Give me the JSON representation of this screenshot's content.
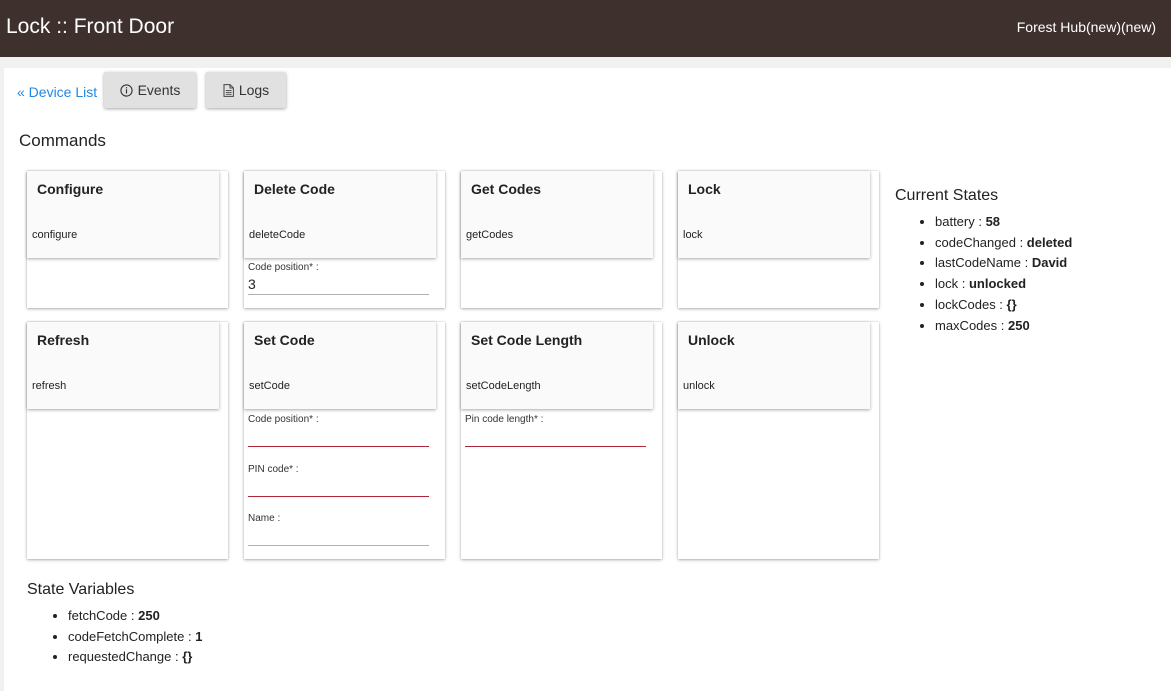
{
  "header": {
    "title": "Lock :: Front Door",
    "hub": "Forest Hub(new)(new)"
  },
  "nav": {
    "device_list": "« Device List",
    "events": "Events",
    "logs": "Logs"
  },
  "commands": {
    "title": "Commands",
    "configure": {
      "name": "Configure",
      "cmd": "configure"
    },
    "delete_code": {
      "name": "Delete Code",
      "cmd": "deleteCode",
      "code_position_label": "Code position* :",
      "code_position_value": "3"
    },
    "get_codes": {
      "name": "Get Codes",
      "cmd": "getCodes"
    },
    "lock": {
      "name": "Lock",
      "cmd": "lock"
    },
    "refresh": {
      "name": "Refresh",
      "cmd": "refresh"
    },
    "set_code": {
      "name": "Set Code",
      "cmd": "setCode",
      "code_position_label": "Code position* :",
      "code_position_value": "",
      "pin_label": "PIN code* :",
      "pin_value": "",
      "name_label": "Name :",
      "name_value": ""
    },
    "set_code_length": {
      "name": "Set Code Length",
      "cmd": "setCodeLength",
      "pin_length_label": "Pin code length* :",
      "pin_length_value": ""
    },
    "unlock": {
      "name": "Unlock",
      "cmd": "unlock"
    }
  },
  "current_states": {
    "title": "Current States",
    "items": [
      {
        "key": "battery : ",
        "value": "58"
      },
      {
        "key": "codeChanged : ",
        "value": "deleted"
      },
      {
        "key": "lastCodeName : ",
        "value": "David"
      },
      {
        "key": "lock : ",
        "value": "unlocked"
      },
      {
        "key": "lockCodes : ",
        "value": "{}"
      },
      {
        "key": "maxCodes : ",
        "value": "250"
      }
    ]
  },
  "state_variables": {
    "title": "State Variables",
    "items": [
      {
        "key": "fetchCode : ",
        "value": "250"
      },
      {
        "key": "codeFetchComplete : ",
        "value": "1"
      },
      {
        "key": "requestedChange : ",
        "value": "{}"
      }
    ]
  },
  "colors": {
    "header_bg": "#3e312d",
    "link": "#1e88e5",
    "required_underline": "#b0263a"
  }
}
